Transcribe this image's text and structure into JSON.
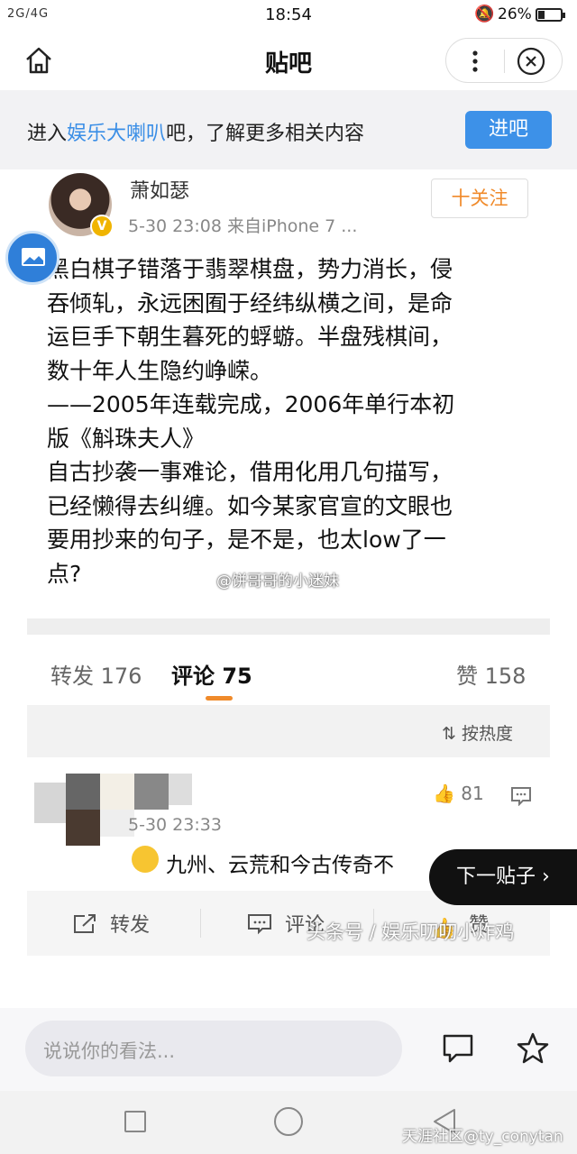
{
  "status_bar": {
    "signal": "2G/4G",
    "time": "18:54",
    "battery": "26%"
  },
  "header": {
    "title": "贴吧"
  },
  "enter_bar": {
    "prefix": "进入",
    "link": "娱乐大喇叭",
    "suffix": "吧，了解更多相关内容",
    "button": "进吧"
  },
  "post": {
    "author": "萧如瑟",
    "meta": "5-30 23:08  来自iPhone 7 ...",
    "follow": "十关注",
    "lines": [
      "黑白棋子错落于翡翠棋盘，势力消长，侵",
      "吞倾轧，永远困囿于经纬纵横之间，是命",
      "运巨手下朝生暮死的蜉蝣。半盘残棋间，",
      "数十年人生隐约峥嵘。",
      "——2005年连载完成，2006年单行本初",
      "版《斛珠夫人》",
      "自古抄袭一事难论，借用化用几句描写，",
      "已经懒得去纠缠。如今某家官宣的文眼也",
      "要用抄来的句子，是不是，也太low了一",
      "点?"
    ],
    "watermark": "@饼哥哥的小迷妹"
  },
  "tabs": {
    "repost": "转发 176",
    "comment": "评论 75",
    "like": "赞 158"
  },
  "sort": "按热度",
  "comment": {
    "likes": "81",
    "time": "5-30 23:33",
    "text": "九州、云荒和今古传奇不",
    "actions": {
      "repost": "转发",
      "comment": "评论",
      "like": "赞"
    },
    "watermark": "头条号 / 娱乐叨叨小炸鸡"
  },
  "next_post": "下一贴子 ›",
  "input": {
    "placeholder": "说说你的看法..."
  },
  "bottom_watermark": "天涯社区@ty_conytan",
  "colors": {
    "accent": "#3d91e8",
    "orange": "#f08a2a"
  }
}
